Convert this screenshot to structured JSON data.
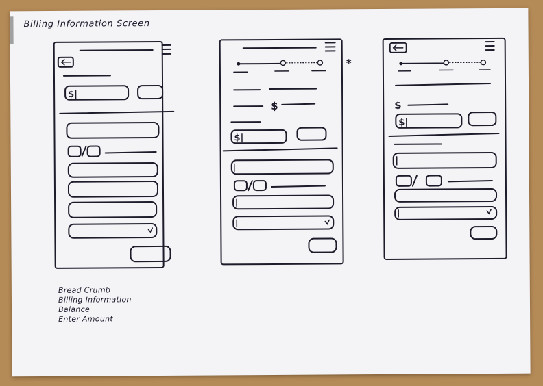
{
  "title": "Billing Information Screen",
  "legend": [
    "Bread Crumb",
    "Billing Information",
    "Balance",
    "Enter Amount"
  ],
  "annotation_mark": "*",
  "currency_symbol": "$",
  "wireframes": [
    {
      "id": "screen-1",
      "breadcrumb": false,
      "balance": false
    },
    {
      "id": "screen-2",
      "breadcrumb": true,
      "balance": true
    },
    {
      "id": "screen-3",
      "breadcrumb": true,
      "balance": true
    }
  ]
}
